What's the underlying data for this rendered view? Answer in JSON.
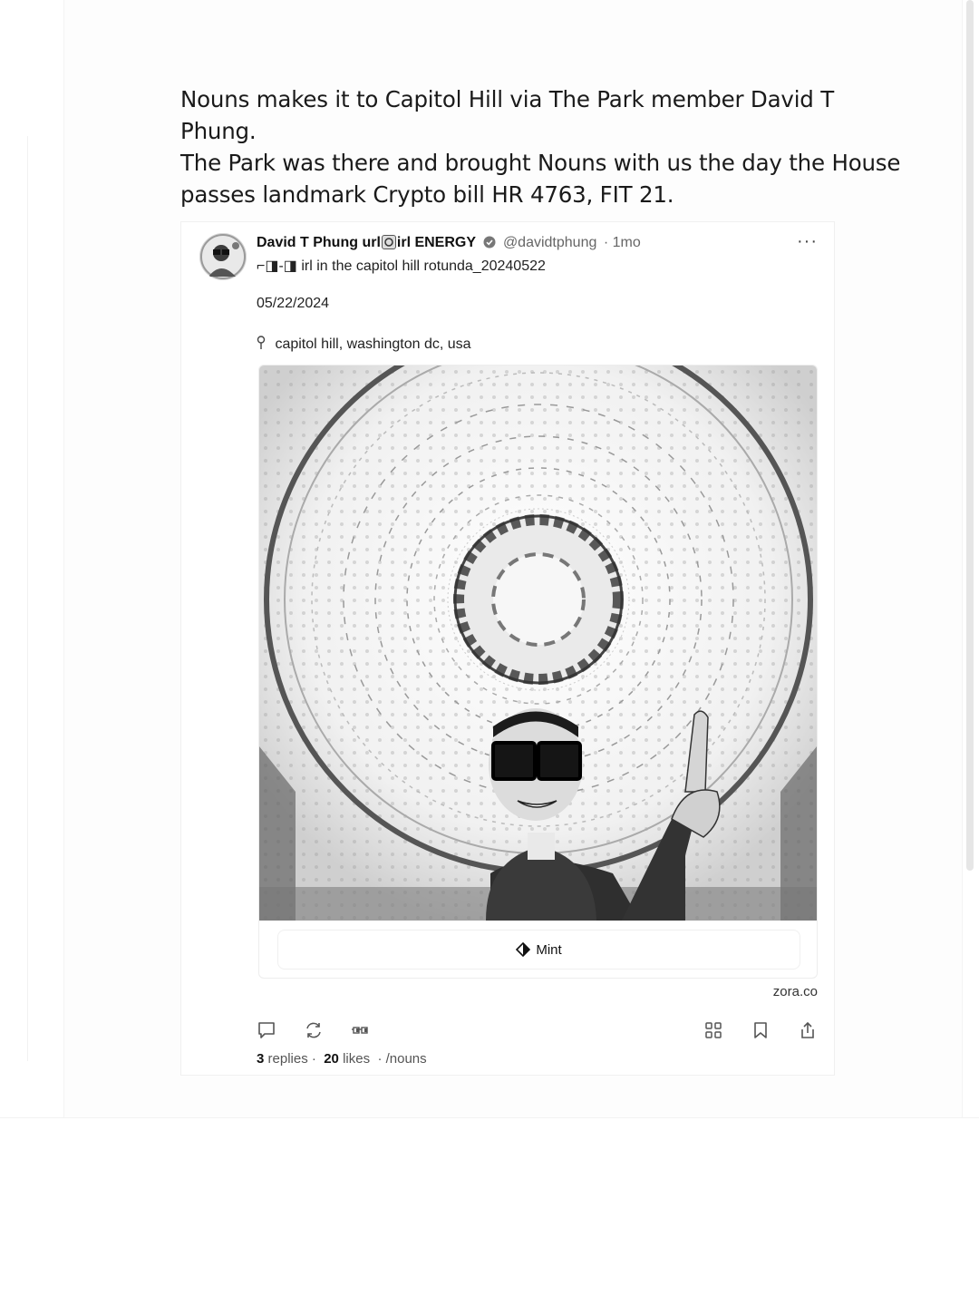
{
  "caption": {
    "line1": "Nouns makes it to Capitol Hill via The Park member David T Phung.",
    "line2": "The Park was there and brought Nouns with us the day the House",
    "line3": "passes landmark Crypto bill HR 4763, FIT 21."
  },
  "post": {
    "display_name_part1": "David T Phung url",
    "display_name_part2": "irl ENERGY",
    "handle": "@davidtphung",
    "age": "· 1mo",
    "more_label": "···",
    "subtitle_glasses": "⌐◨-◨",
    "subtitle_text": "irl in the capitol hill rotunda_20240522",
    "date": "05/22/2024",
    "location": "capitol hill, washington dc, usa",
    "mint_label": "Mint",
    "source": "zora.co",
    "stats": {
      "replies_count": "3",
      "replies_label": "replies ·",
      "likes_count": "20",
      "likes_label": "likes",
      "channel": "· /nouns"
    }
  },
  "icons": {
    "verified": "verified-badge-icon",
    "location": "map-pin-icon",
    "mint": "diamond-icon",
    "reply": "comment-icon",
    "recast": "recast-icon",
    "react": "noggles-icon",
    "apps": "grid-icon",
    "bookmark": "bookmark-icon",
    "share": "share-icon"
  }
}
